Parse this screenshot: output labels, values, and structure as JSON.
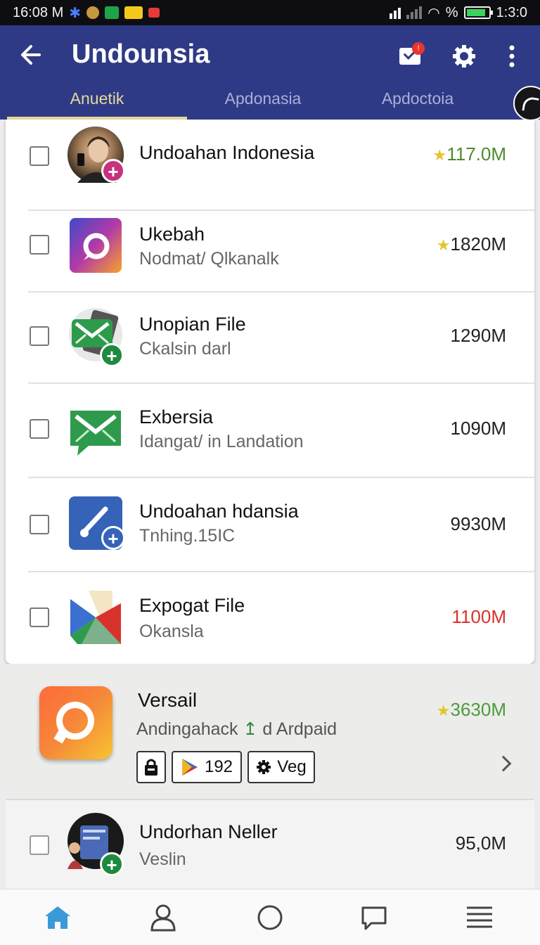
{
  "status": {
    "time": "16:08 M",
    "percent": "%",
    "clock": "1:3:0"
  },
  "appbar": {
    "title": "Undounsia",
    "badge": "!",
    "tabs": [
      "Anuetik",
      "Apdonasia",
      "Apdoctoia"
    ]
  },
  "rows": [
    {
      "name": "Undoahan Indonesia",
      "subtitle": "",
      "size": "117.0M",
      "size_color": "#4f8a2e",
      "star": true
    },
    {
      "name": "Ukebah",
      "subtitle": "Nodmat/ Qlkanalk",
      "size": "1820M",
      "size_color": "#222222",
      "star": true
    },
    {
      "name": "Unopian File",
      "subtitle": "Ckalsin darl",
      "size": "1290M",
      "size_color": "#222222",
      "star": false
    },
    {
      "name": "Exbersia",
      "subtitle": "Idangat/ in Landation",
      "size": "1090M",
      "size_color": "#222222",
      "star": false
    },
    {
      "name": "Undoahan hdansia",
      "subtitle": "Tnhing.15IC",
      "size": "9930M",
      "size_color": "#222222",
      "star": false
    },
    {
      "name": "Expogat File",
      "subtitle": "Okansla",
      "size": "1100M",
      "size_color": "#d8322c",
      "star": false
    }
  ],
  "featured": {
    "name": "Versail",
    "subtitle_a": "Andingahack",
    "subtitle_mid": "↥",
    "subtitle_b": "d Ardpaid",
    "size": "3630M",
    "chips": {
      "store_count": "192",
      "tag": "Veg"
    }
  },
  "last_row": {
    "name": "Undorhan Neller",
    "subtitle": "Veslin",
    "size": "95,0M"
  },
  "icons": {
    "nav": [
      "home-icon",
      "profile-icon",
      "circle-icon",
      "chat-icon",
      "menu-icon"
    ]
  },
  "colors": {
    "appbar": "#2f3a86",
    "tab_active": "#e8d89c",
    "nav_active": "#3a9ad9"
  }
}
